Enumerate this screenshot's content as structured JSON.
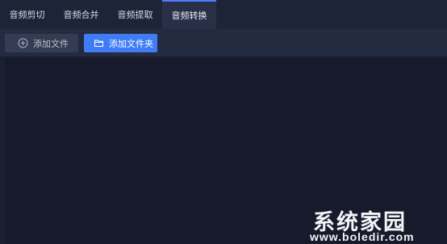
{
  "tabs": [
    {
      "label": "音频剪切",
      "active": false
    },
    {
      "label": "音频合并",
      "active": false
    },
    {
      "label": "音频提取",
      "active": false
    },
    {
      "label": "音频转换",
      "active": true
    }
  ],
  "toolbar": {
    "add_file_label": "添加文件",
    "add_file_icon": "plus-circle-icon",
    "add_folder_label": "添加文件夹",
    "add_folder_icon": "folder-icon"
  },
  "colors": {
    "accent": "#3f7cf6",
    "background": "#1a1f32"
  },
  "watermark": {
    "title": "系统家园",
    "url": "www.boledir.com"
  }
}
